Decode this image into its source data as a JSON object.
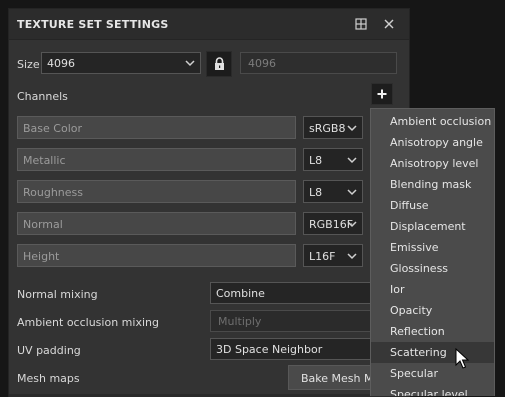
{
  "panel": {
    "title": "TEXTURE SET SETTINGS",
    "size_label": "Size",
    "size_value": "4096",
    "size_linked_value": "4096",
    "channels_label": "Channels",
    "channels": [
      {
        "name": "Base Color",
        "format": "sRGB8"
      },
      {
        "name": "Metallic",
        "format": "L8"
      },
      {
        "name": "Roughness",
        "format": "L8"
      },
      {
        "name": "Normal",
        "format": "RGB16F"
      },
      {
        "name": "Height",
        "format": "L16F"
      }
    ],
    "normal_mixing_label": "Normal mixing",
    "normal_mixing_value": "Combine",
    "ao_mixing_label": "Ambient occlusion mixing",
    "ao_mixing_placeholder": "Multiply",
    "uv_padding_label": "UV padding",
    "uv_padding_value": "3D Space Neighbor",
    "mesh_maps_label": "Mesh maps",
    "bake_button_label": "Bake Mesh Ma"
  },
  "menu": {
    "items": [
      "Ambient occlusion",
      "Anisotropy angle",
      "Anisotropy level",
      "Blending mask",
      "Diffuse",
      "Displacement",
      "Emissive",
      "Glossiness",
      "Ior",
      "Opacity",
      "Reflection",
      "Scattering",
      "Specular",
      "Specular level"
    ],
    "highlighted": "Scattering"
  },
  "colors": {
    "panel_bg": "#333333",
    "menu_bg": "#4b4b4b",
    "highlight": "#373737"
  }
}
